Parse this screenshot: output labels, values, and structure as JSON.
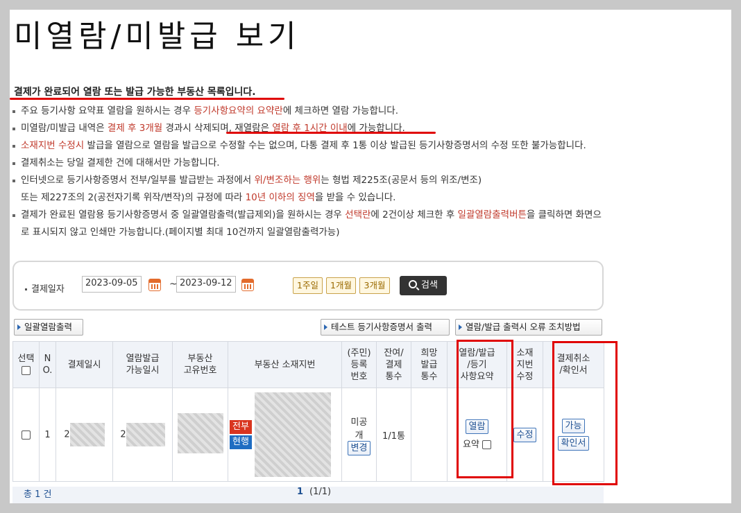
{
  "page": {
    "title": "미열람/미발급 보기",
    "headline": "결제가 완료되어 열람 또는 발급 가능한 부동산 목록입니다."
  },
  "notes": [
    {
      "segments": [
        {
          "text": "주요 등기사항 요약표 열람을 원하시는 경우 ",
          "red": false
        },
        {
          "text": "등기사항요약의 요약란",
          "red": true
        },
        {
          "text": "에 체크하면 열람 가능합니다.",
          "red": false
        }
      ]
    },
    {
      "segments": [
        {
          "text": "미열람/미발급 내역은 ",
          "red": false
        },
        {
          "text": "결제 후 3개월",
          "red": true
        },
        {
          "text": " 경과시 삭제되며, 재열람은 ",
          "red": false
        },
        {
          "text": "열람 후 1시간 이내",
          "red": true
        },
        {
          "text": "에 가능합니다.",
          "red": false
        }
      ]
    },
    {
      "segments": [
        {
          "text": "소재지번 수정시",
          "red": true
        },
        {
          "text": " 발급을 열람으로 열람을 발급으로 수정할 수는 없으며, 다통 결제 후 1통 이상 발급된 등기사항증명서의 수정 또한 불가능합니다.",
          "red": false
        }
      ]
    },
    {
      "segments": [
        {
          "text": "결제취소는 당일 결제한 건에 대해서만 가능합니다.",
          "red": false
        }
      ]
    },
    {
      "segments": [
        {
          "text": "인터넷으로 등기사항증명서 전부/일부를 발급받는 과정에서 ",
          "red": false
        },
        {
          "text": "위/변조하는 행위",
          "red": true
        },
        {
          "text": "는 형법 제225조(공문서 등의 위조/변조)",
          "red": false
        }
      ],
      "second_line": [
        {
          "text": "또는 제227조의 2(공전자기록 위작/변작)의 규정에 따라 ",
          "red": false
        },
        {
          "text": "10년 이하의 징역",
          "red": true
        },
        {
          "text": "을 받을 수 있습니다.",
          "red": false
        }
      ]
    },
    {
      "segments": [
        {
          "text": "결제가 완료된 열람용 등기사항증명서 중 일괄열람출력(발급제외)을 원하시는 경우 ",
          "red": false
        },
        {
          "text": "선택란",
          "red": true
        },
        {
          "text": "에 2건이상 체크한 후 ",
          "red": false
        },
        {
          "text": "일괄열람출력버튼",
          "red": true
        },
        {
          "text": "을 클릭하면 화면으로 표시되지 않고 인쇄만 가능합니다.(페이지별 최대 10건까지 일괄열람출력가능)",
          "red": false
        }
      ]
    }
  ],
  "search": {
    "label": "결제일자",
    "date_from": "2023-09-05",
    "date_to": "2023-09-12",
    "tilde": "~",
    "period_buttons": [
      "1주일",
      "1개월",
      "3개월"
    ],
    "search_button": "검색"
  },
  "toolbar": {
    "bulk_print": "일괄열람출력",
    "test_print": "테스트 등기사항증명서 출력",
    "error_guide": "열람/발급 출력시 오류 조치방법"
  },
  "table": {
    "headers": [
      "선택",
      "NO.",
      "결제일시",
      "열람발급가능일시",
      "부동산고유번호",
      "부동산 소재지번",
      "(주민)등록번호",
      "잔여/결제통수",
      "희망발급통수",
      "열람/발급/등기사항요약",
      "소재지번수정",
      "결제취소/확인서"
    ],
    "header_lines": [
      [
        "선택"
      ],
      [
        "N",
        "O."
      ],
      [
        "결제일시"
      ],
      [
        "열람발급",
        "가능일시"
      ],
      [
        "부동산",
        "고유번호"
      ],
      [
        "부동산 소재지번"
      ],
      [
        "(주민)",
        "등록",
        "번호"
      ],
      [
        "잔여/",
        "결제",
        "통수"
      ],
      [
        "희망",
        "발급",
        "통수"
      ],
      [
        "열람/발급",
        "/등기",
        "사항요약"
      ],
      [
        "소재",
        "지번",
        "수정"
      ],
      [
        "결제취소",
        "/확인서"
      ]
    ],
    "rows": [
      {
        "no": "1",
        "paid_at_prefix": "2",
        "available_at_prefix": "2",
        "badge_scope": "전부",
        "badge_status": "현행",
        "reg_no_lines": [
          "미공",
          "개"
        ],
        "reg_no_button": "변경",
        "remain_count": "1/1통",
        "view_button": "열람",
        "summary_label": "요약",
        "edit_button": "수정",
        "cancel_button": "가능",
        "receipt_button": "확인서"
      }
    ]
  },
  "footer": {
    "total": "총 1 건",
    "page_current": "1",
    "page_info": "(1/1)"
  },
  "colors": {
    "annotation_red": "#e00000",
    "note_red": "#c0392b",
    "badge_scope": "#d9351f",
    "badge_status": "#1f6dc2"
  }
}
